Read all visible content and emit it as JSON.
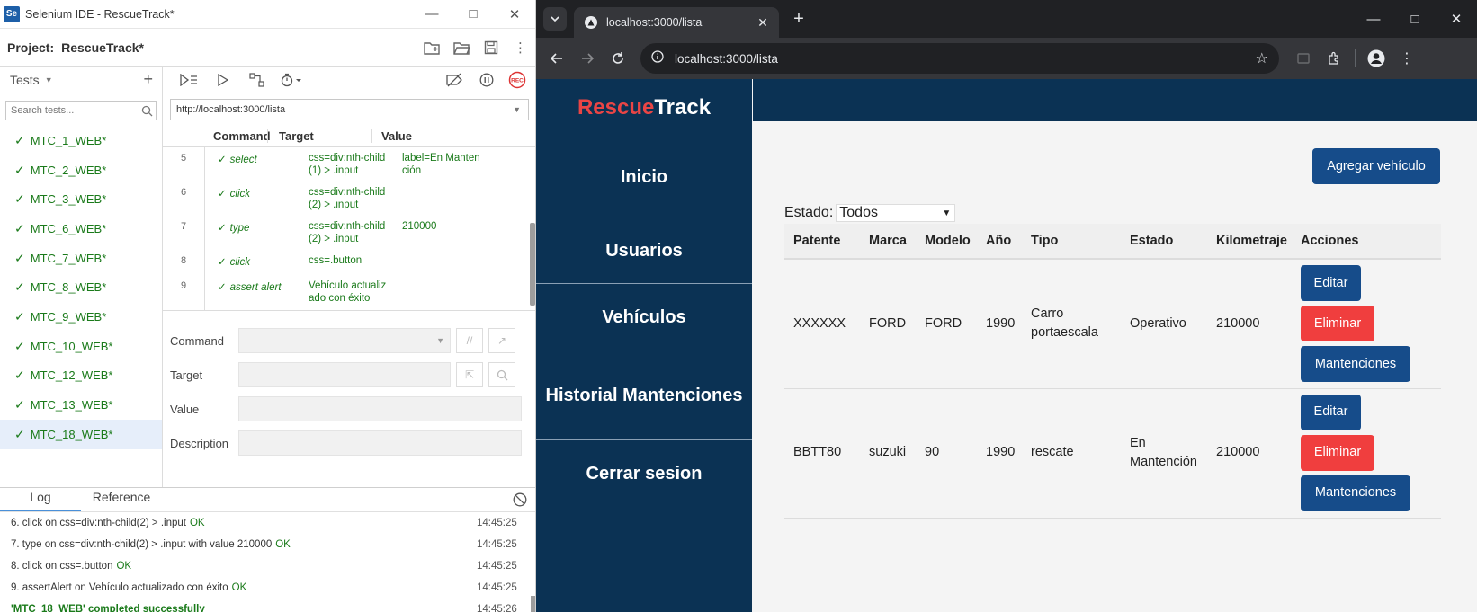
{
  "ide": {
    "window_title": "Selenium IDE - RescueTrack*",
    "logo_text": "Se",
    "project_label": "Project:",
    "project_name": "RescueTrack*",
    "tests_label": "Tests",
    "search_placeholder": "Search tests...",
    "tests": [
      "MTC_1_WEB*",
      "MTC_2_WEB*",
      "MTC_3_WEB*",
      "MTC_6_WEB*",
      "MTC_7_WEB*",
      "MTC_8_WEB*",
      "MTC_9_WEB*",
      "MTC_10_WEB*",
      "MTC_12_WEB*",
      "MTC_13_WEB*",
      "MTC_18_WEB*"
    ],
    "active_test": "MTC_18_WEB*",
    "base_url": "http://localhost:3000/lista",
    "columns": [
      "Command",
      "Target",
      "Value"
    ],
    "commands": [
      {
        "num": "5",
        "command": "select",
        "target": "css=div:nth-child (1) > .input",
        "value": "label=En Manten ción"
      },
      {
        "num": "6",
        "command": "click",
        "target": "css=div:nth-child (2) > .input",
        "value": ""
      },
      {
        "num": "7",
        "command": "type",
        "target": "css=div:nth-child (2) > .input",
        "value": "210000"
      },
      {
        "num": "8",
        "command": "click",
        "target": "css=.button",
        "value": ""
      },
      {
        "num": "9",
        "command": "assert alert",
        "target": "Vehículo actualiz ado con éxito",
        "value": ""
      }
    ],
    "form": {
      "command": "Command",
      "target": "Target",
      "value": "Value",
      "description": "Description"
    },
    "log_tabs": [
      "Log",
      "Reference"
    ],
    "log": [
      {
        "msg": "6.  click on css=div:nth-child(2) > .input",
        "ok": "OK",
        "time": "14:45:25"
      },
      {
        "msg": "7.  type on css=div:nth-child(2) > .input with value 210000",
        "ok": "OK",
        "time": "14:45:25"
      },
      {
        "msg": "8.  click on css=.button",
        "ok": "OK",
        "time": "14:45:25"
      },
      {
        "msg": "9.  assertAlert on Vehículo actualizado con éxito",
        "ok": "OK",
        "time": "14:45:25"
      },
      {
        "msg": "'MTC_18_WEB' completed successfully",
        "ok": "",
        "time": "14:45:26"
      }
    ]
  },
  "browser": {
    "tab_title": "localhost:3000/lista",
    "url": "localhost:3000/lista"
  },
  "app": {
    "brand_part1": "Rescue",
    "brand_part2": "Track",
    "nav": [
      "Inicio",
      "Usuarios",
      "Vehículos",
      "Historial Mantenciones",
      "Cerrar sesion"
    ],
    "add_button": "Agregar vehículo",
    "filter_label": "Estado:",
    "filter_value": "Todos",
    "table_headers": [
      "Patente",
      "Marca",
      "Modelo",
      "Año",
      "Tipo",
      "Estado",
      "Kilometraje",
      "Acciones"
    ],
    "rows": [
      {
        "patente": "XXXXXX",
        "marca": "FORD",
        "modelo": "FORD",
        "anio": "1990",
        "tipo": "Carro portaescala",
        "estado": "Operativo",
        "km": "210000"
      },
      {
        "patente": "BBTT80",
        "marca": "suzuki",
        "modelo": "90",
        "anio": "1990",
        "tipo": "rescate",
        "estado": "En Mantención",
        "km": "210000"
      }
    ],
    "actions": {
      "edit": "Editar",
      "delete": "Eliminar",
      "maint": "Mantenciones"
    }
  },
  "colors": {
    "sidebar": "#0b3254",
    "brand_red": "#ea4545",
    "primary_btn": "#164c8a",
    "danger_btn": "#f03e3e",
    "pass_green": "#1a7a1a"
  }
}
